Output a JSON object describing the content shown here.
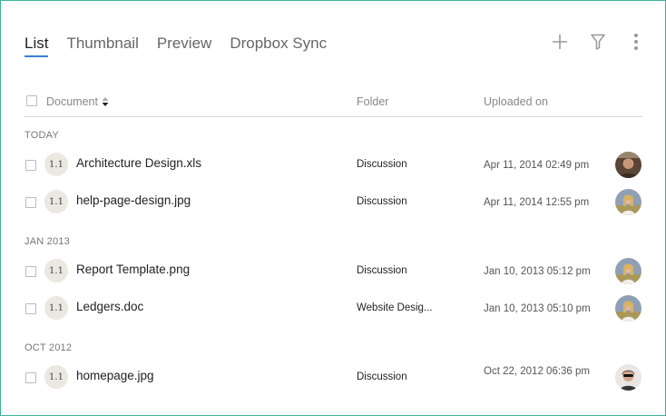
{
  "tabs": [
    {
      "label": "List",
      "active": true
    },
    {
      "label": "Thumbnail",
      "active": false
    },
    {
      "label": "Preview",
      "active": false
    },
    {
      "label": "Dropbox Sync",
      "active": false
    }
  ],
  "actions": {
    "add_icon": "plus-icon",
    "filter_icon": "filter-icon",
    "more_icon": "more-vertical-icon"
  },
  "columns": {
    "document": "Document",
    "folder": "Folder",
    "uploaded": "Uploaded on"
  },
  "groups": [
    {
      "label": "TODAY",
      "rows": [
        {
          "version": "1.1",
          "name": "Architecture Design.xls",
          "folder": "Discussion",
          "uploaded": "Apr 11, 2014 02:49 pm",
          "avatar": "avatar-dark-hair"
        },
        {
          "version": "1.1",
          "name": "help-page-design.jpg",
          "folder": "Discussion",
          "uploaded": "Apr 11, 2014 12:55 pm",
          "avatar": "avatar-blonde"
        }
      ]
    },
    {
      "label": "JAN 2013",
      "rows": [
        {
          "version": "1.1",
          "name": "Report Template.png",
          "folder": "Discussion",
          "uploaded": "Jan 10, 2013 05:12 pm",
          "avatar": "avatar-blonde"
        },
        {
          "version": "1.1",
          "name": "Ledgers.doc",
          "folder": "Website Desig...",
          "uploaded": "Jan 10, 2013 05:10 pm",
          "avatar": "avatar-blonde"
        }
      ]
    },
    {
      "label": "OCT 2012",
      "rows": [
        {
          "version": "1.1",
          "name": "homepage.jpg",
          "folder": "Discussion",
          "uploaded": "Oct 22, 2012 06:36 pm",
          "avatar": "avatar-sunglasses"
        }
      ]
    }
  ],
  "colors": {
    "accent": "#3a7fd5",
    "frame_border": "#3fb39a"
  }
}
